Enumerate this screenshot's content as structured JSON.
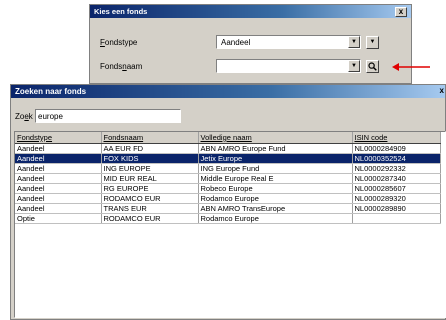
{
  "dialog_kies": {
    "title": "Kies een fonds",
    "close_label": "x",
    "fondstype_label": "Fondstype",
    "fondstype_value": "Aandeel",
    "fondsnaam_label": "Fondsnaam",
    "fondsnaam_value": ""
  },
  "dialog_zoeken": {
    "title": "Zoeken naar fonds",
    "close_label": "x",
    "zoek_label": "Zoek",
    "zoek_value": "europe",
    "columns": [
      "Fondstype",
      "Fondsnaam",
      "Volledige naam",
      "ISIN code"
    ],
    "rows": [
      [
        "Aandeel",
        "AA EUR FD",
        "ABN AMRO Europe Fund",
        "NL0000284909"
      ],
      [
        "Aandeel",
        "FOX KIDS",
        "Jetix Europe",
        "NL0000352524"
      ],
      [
        "Aandeel",
        "ING EUROPE",
        "ING Europe Fund",
        "NL0000292332"
      ],
      [
        "Aandeel",
        "MID EUR REAL",
        "Middle Europe Real E",
        "NL0000287340"
      ],
      [
        "Aandeel",
        "RG EUROPE",
        "Robeco Europe",
        "NL0000285607"
      ],
      [
        "Aandeel",
        "RODAMCO EUR",
        "Rodamco Europe",
        "NL0000289320"
      ],
      [
        "Aandeel",
        "TRANS EUR",
        "ABN AMRO TransEurope",
        "NL0000289890"
      ],
      [
        "Optie",
        "RODAMCO EUR",
        "Rodamco Europe",
        ""
      ]
    ],
    "selected_row_index": 1
  },
  "colors": {
    "title_bar": "#0a246a",
    "selection": "#0a246a",
    "annotation_arrow": "#e00000",
    "window_face": "#d4d0c8"
  }
}
